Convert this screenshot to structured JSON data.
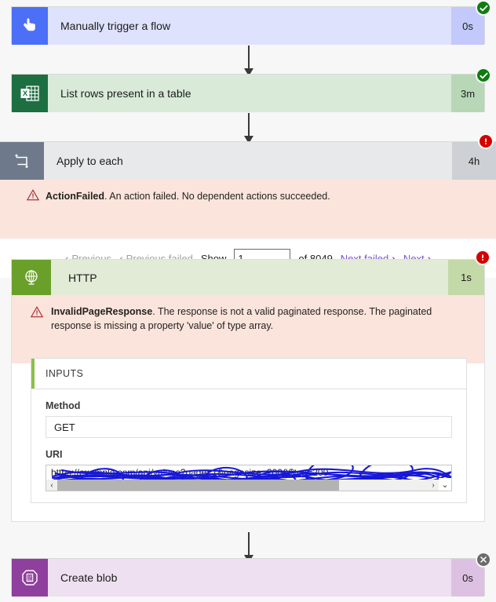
{
  "flow": {
    "nodes": [
      {
        "id": "manual-trigger",
        "title": "Manually trigger a flow",
        "duration": "0s",
        "status": "succeeded",
        "icon": "hand-pointer-icon",
        "icon_bg": "#4C6FF7",
        "body_bg": "#dfe2fc",
        "dur_bg": "#c3c9fa"
      },
      {
        "id": "list-rows",
        "title": "List rows present in a table",
        "duration": "3m",
        "status": "succeeded",
        "icon": "excel-table-icon",
        "icon_bg": "#1d6f42",
        "body_bg": "#d9ead9",
        "dur_bg": "#b7d7b7"
      },
      {
        "id": "apply-to-each",
        "title": "Apply to each",
        "duration": "4h",
        "status": "failed",
        "icon": "loop-icon",
        "icon_bg": "#6e7a8c",
        "body_bg": "#e8e9eb",
        "dur_bg": "#cdd0d4"
      },
      {
        "id": "http",
        "title": "HTTP",
        "duration": "1s",
        "status": "failed",
        "icon": "globe-icon",
        "icon_bg": "#6aa02a",
        "body_bg": "#e2ebd6",
        "dur_bg": "#c4d9a8"
      },
      {
        "id": "create-blob",
        "title": "Create blob",
        "duration": "0s",
        "status": "skipped",
        "icon": "blob-storage-icon",
        "icon_bg": "#8f3f9e",
        "body_bg": "#eee0f0",
        "dur_bg": "#ddc1e3"
      }
    ],
    "errors": {
      "apply_to_each": {
        "code": "ActionFailed",
        "message": ". An action failed. No dependent actions succeeded."
      },
      "http": {
        "code": "InvalidPageResponse",
        "message": ". The response is not a valid paginated response. The paginated response is missing a property 'value' of type array."
      }
    },
    "pager": {
      "previous": "Previous",
      "previous_failed": "Previous failed",
      "show_label": "Show",
      "page_value": "1",
      "of_label": "of 8049",
      "next_failed": "Next failed",
      "next": "Next",
      "chevron_left": "‹",
      "chevron_right": "›",
      "disabled_color": "#a19f9d",
      "active_color": "#7a52c7"
    },
    "inputs_card": {
      "header": "INPUTS",
      "accent_color": "#8cbf4a",
      "method_label": "Method",
      "method_value": "GET",
      "uri_label": "URI",
      "uri_value": "https://example.com/api/values?page=1&pagesize=200&$top=200",
      "redacted": true
    },
    "status_glyphs": {
      "succeeded": "✔",
      "failed": "!",
      "skipped": "✕"
    }
  }
}
